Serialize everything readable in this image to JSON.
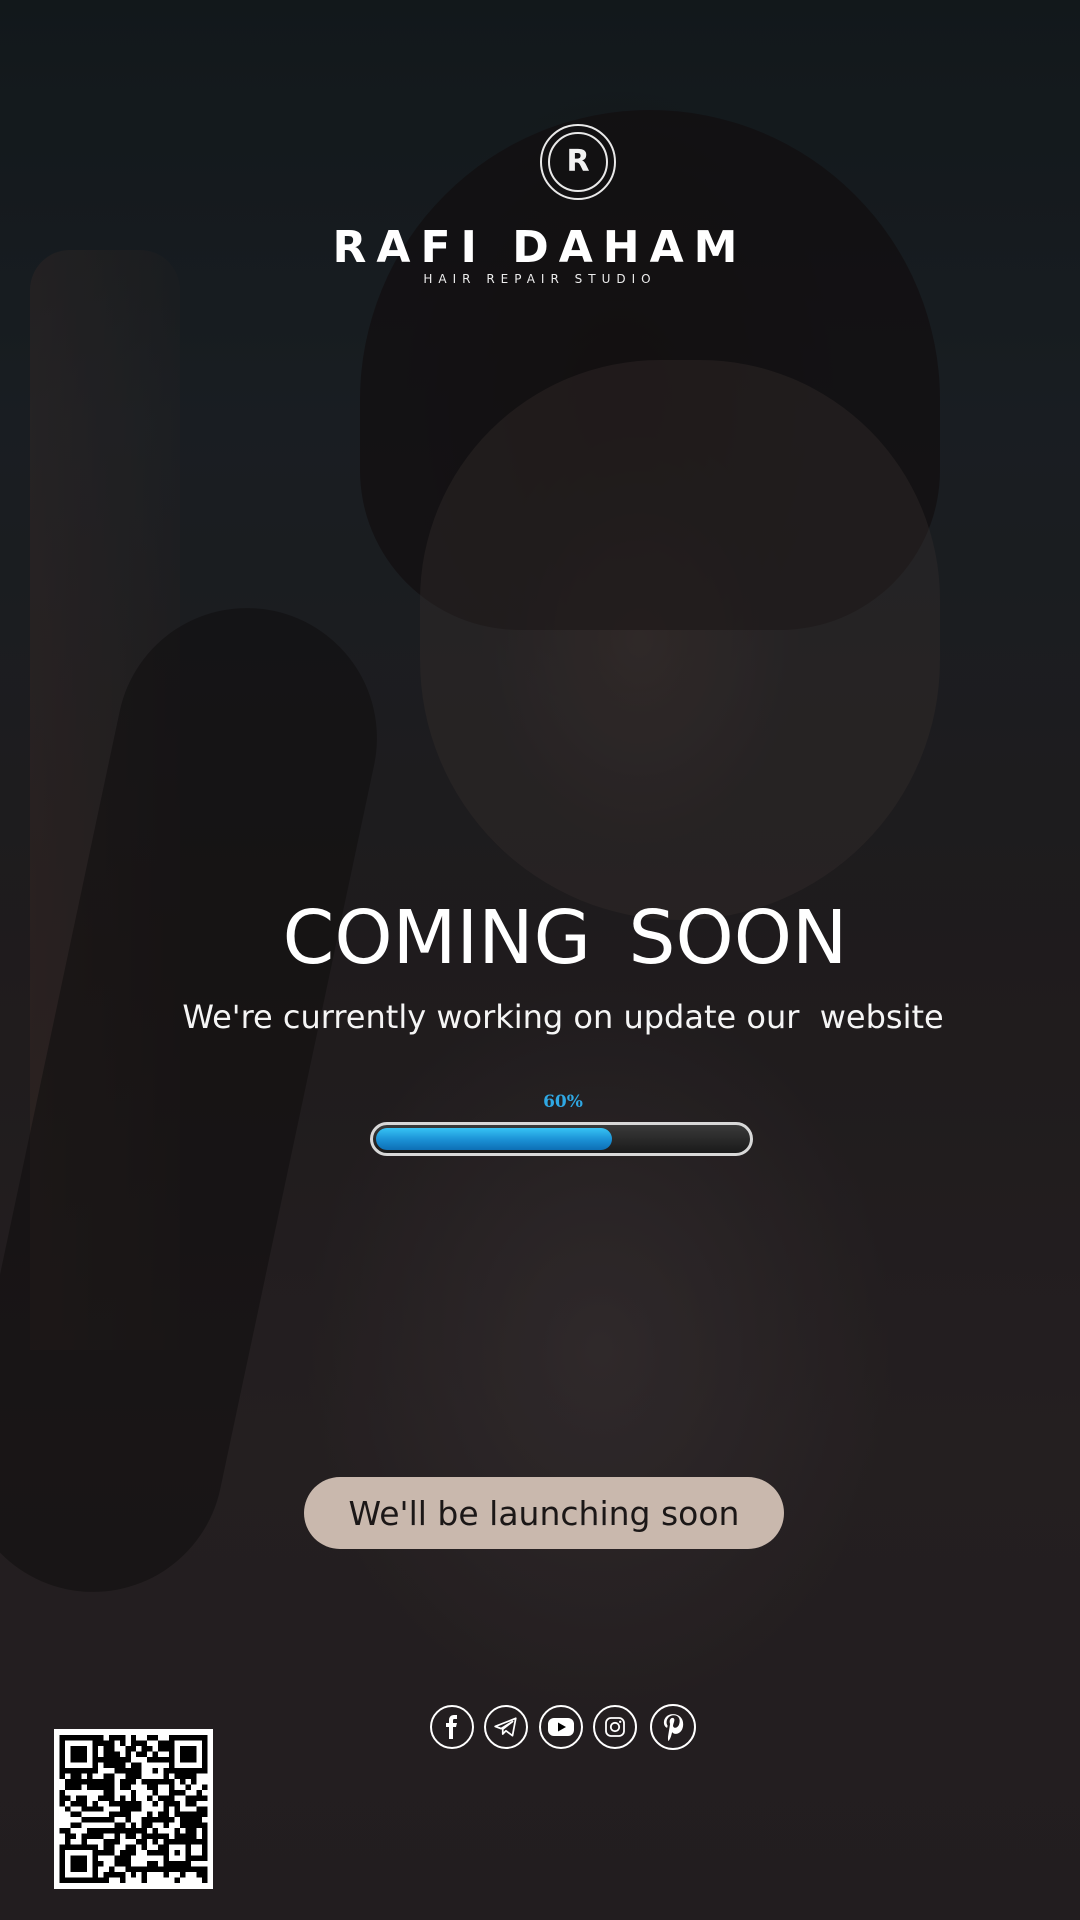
{
  "brand": {
    "monogram": "R",
    "name": "RAFI DAHAM",
    "tagline": "HAIR REPAIR STUDIO"
  },
  "hero": {
    "headline": "COMING  SOON",
    "subline": "We're currently working on update our  website"
  },
  "progress": {
    "label": "60%",
    "value": 0.6,
    "accent": "#2fa8e4"
  },
  "cta": {
    "label": "We'll be launching soon",
    "background": "#c9b8ad"
  },
  "social": [
    {
      "icon": "facebook-icon"
    },
    {
      "icon": "telegram-icon"
    },
    {
      "icon": "youtube-icon"
    },
    {
      "icon": "instagram-icon"
    },
    {
      "icon": "pinterest-icon"
    }
  ],
  "qr": {
    "icon": "qr-code"
  }
}
